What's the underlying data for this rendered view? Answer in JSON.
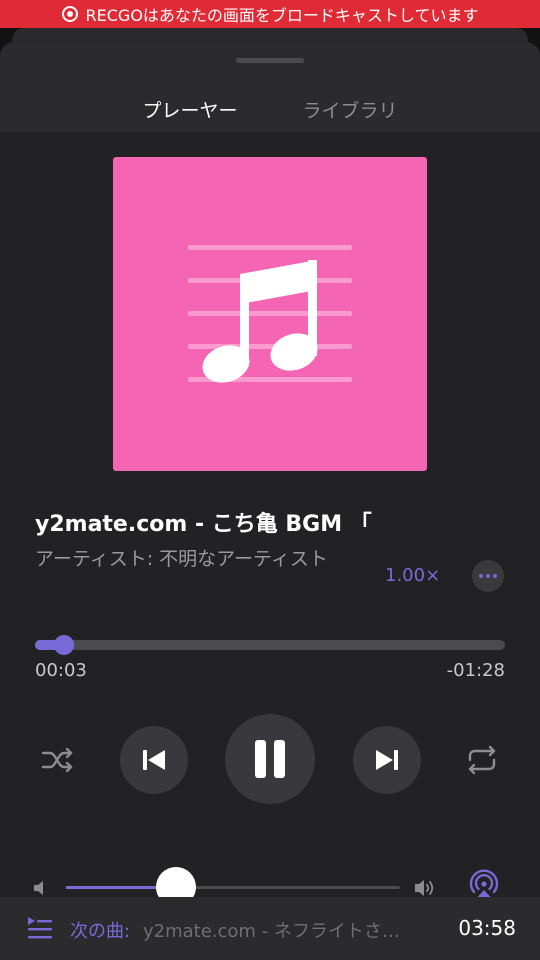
{
  "recording_banner": {
    "text": "RECGOはあなたの画面をブロードキャストしています"
  },
  "tabs": [
    {
      "label": "プレーヤー",
      "active": true
    },
    {
      "label": "ライブラリ",
      "active": false
    }
  ],
  "track": {
    "title": "y2mate.com - こち亀 BGM 「",
    "artist": "アーティスト: 不明なアーティスト",
    "artwork_icon": "music-note-icon",
    "artwork_color": "#f466b3"
  },
  "speed_label": "1.00×",
  "progress": {
    "elapsed": "00:03",
    "remaining": "-01:28",
    "fraction": 0.062
  },
  "controls": {
    "shuffle_icon": "shuffle-icon",
    "previous_icon": "skip-previous-icon",
    "play_state_icon": "pause-icon",
    "next_icon": "skip-next-icon",
    "repeat_icon": "repeat-icon"
  },
  "volume": {
    "level": 0.33,
    "airplay_icon": "airplay-icon"
  },
  "up_next": {
    "label": "次の曲:",
    "title": "y2mate.com - ネフライトさ…",
    "duration": "03:58"
  },
  "colors": {
    "accent": "#7a6ad8",
    "recording": "#e02a36",
    "background": "#222124"
  }
}
